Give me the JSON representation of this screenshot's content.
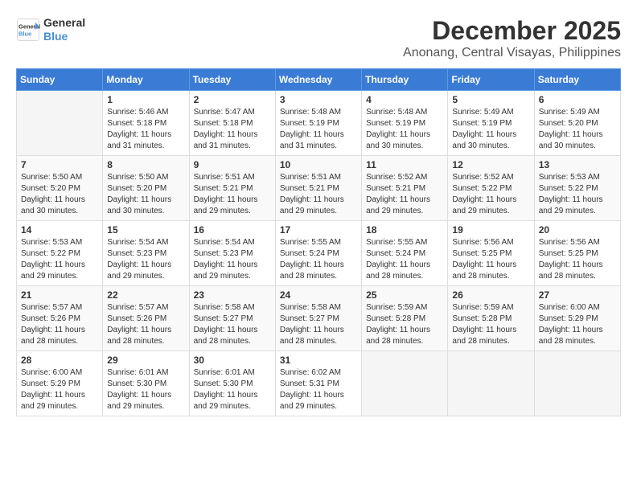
{
  "header": {
    "logo": {
      "line1": "General",
      "line2": "Blue"
    },
    "month_year": "December 2025",
    "location": "Anonang, Central Visayas, Philippines"
  },
  "days_of_week": [
    "Sunday",
    "Monday",
    "Tuesday",
    "Wednesday",
    "Thursday",
    "Friday",
    "Saturday"
  ],
  "weeks": [
    [
      {
        "day": "",
        "info": ""
      },
      {
        "day": "1",
        "info": "Sunrise: 5:46 AM\nSunset: 5:18 PM\nDaylight: 11 hours and 31 minutes."
      },
      {
        "day": "2",
        "info": "Sunrise: 5:47 AM\nSunset: 5:18 PM\nDaylight: 11 hours and 31 minutes."
      },
      {
        "day": "3",
        "info": "Sunrise: 5:48 AM\nSunset: 5:19 PM\nDaylight: 11 hours and 31 minutes."
      },
      {
        "day": "4",
        "info": "Sunrise: 5:48 AM\nSunset: 5:19 PM\nDaylight: 11 hours and 30 minutes."
      },
      {
        "day": "5",
        "info": "Sunrise: 5:49 AM\nSunset: 5:19 PM\nDaylight: 11 hours and 30 minutes."
      },
      {
        "day": "6",
        "info": "Sunrise: 5:49 AM\nSunset: 5:20 PM\nDaylight: 11 hours and 30 minutes."
      }
    ],
    [
      {
        "day": "7",
        "info": "Sunrise: 5:50 AM\nSunset: 5:20 PM\nDaylight: 11 hours and 30 minutes."
      },
      {
        "day": "8",
        "info": "Sunrise: 5:50 AM\nSunset: 5:20 PM\nDaylight: 11 hours and 30 minutes."
      },
      {
        "day": "9",
        "info": "Sunrise: 5:51 AM\nSunset: 5:21 PM\nDaylight: 11 hours and 29 minutes."
      },
      {
        "day": "10",
        "info": "Sunrise: 5:51 AM\nSunset: 5:21 PM\nDaylight: 11 hours and 29 minutes."
      },
      {
        "day": "11",
        "info": "Sunrise: 5:52 AM\nSunset: 5:21 PM\nDaylight: 11 hours and 29 minutes."
      },
      {
        "day": "12",
        "info": "Sunrise: 5:52 AM\nSunset: 5:22 PM\nDaylight: 11 hours and 29 minutes."
      },
      {
        "day": "13",
        "info": "Sunrise: 5:53 AM\nSunset: 5:22 PM\nDaylight: 11 hours and 29 minutes."
      }
    ],
    [
      {
        "day": "14",
        "info": "Sunrise: 5:53 AM\nSunset: 5:22 PM\nDaylight: 11 hours and 29 minutes."
      },
      {
        "day": "15",
        "info": "Sunrise: 5:54 AM\nSunset: 5:23 PM\nDaylight: 11 hours and 29 minutes."
      },
      {
        "day": "16",
        "info": "Sunrise: 5:54 AM\nSunset: 5:23 PM\nDaylight: 11 hours and 29 minutes."
      },
      {
        "day": "17",
        "info": "Sunrise: 5:55 AM\nSunset: 5:24 PM\nDaylight: 11 hours and 28 minutes."
      },
      {
        "day": "18",
        "info": "Sunrise: 5:55 AM\nSunset: 5:24 PM\nDaylight: 11 hours and 28 minutes."
      },
      {
        "day": "19",
        "info": "Sunrise: 5:56 AM\nSunset: 5:25 PM\nDaylight: 11 hours and 28 minutes."
      },
      {
        "day": "20",
        "info": "Sunrise: 5:56 AM\nSunset: 5:25 PM\nDaylight: 11 hours and 28 minutes."
      }
    ],
    [
      {
        "day": "21",
        "info": "Sunrise: 5:57 AM\nSunset: 5:26 PM\nDaylight: 11 hours and 28 minutes."
      },
      {
        "day": "22",
        "info": "Sunrise: 5:57 AM\nSunset: 5:26 PM\nDaylight: 11 hours and 28 minutes."
      },
      {
        "day": "23",
        "info": "Sunrise: 5:58 AM\nSunset: 5:27 PM\nDaylight: 11 hours and 28 minutes."
      },
      {
        "day": "24",
        "info": "Sunrise: 5:58 AM\nSunset: 5:27 PM\nDaylight: 11 hours and 28 minutes."
      },
      {
        "day": "25",
        "info": "Sunrise: 5:59 AM\nSunset: 5:28 PM\nDaylight: 11 hours and 28 minutes."
      },
      {
        "day": "26",
        "info": "Sunrise: 5:59 AM\nSunset: 5:28 PM\nDaylight: 11 hours and 28 minutes."
      },
      {
        "day": "27",
        "info": "Sunrise: 6:00 AM\nSunset: 5:29 PM\nDaylight: 11 hours and 28 minutes."
      }
    ],
    [
      {
        "day": "28",
        "info": "Sunrise: 6:00 AM\nSunset: 5:29 PM\nDaylight: 11 hours and 29 minutes."
      },
      {
        "day": "29",
        "info": "Sunrise: 6:01 AM\nSunset: 5:30 PM\nDaylight: 11 hours and 29 minutes."
      },
      {
        "day": "30",
        "info": "Sunrise: 6:01 AM\nSunset: 5:30 PM\nDaylight: 11 hours and 29 minutes."
      },
      {
        "day": "31",
        "info": "Sunrise: 6:02 AM\nSunset: 5:31 PM\nDaylight: 11 hours and 29 minutes."
      },
      {
        "day": "",
        "info": ""
      },
      {
        "day": "",
        "info": ""
      },
      {
        "day": "",
        "info": ""
      }
    ]
  ]
}
